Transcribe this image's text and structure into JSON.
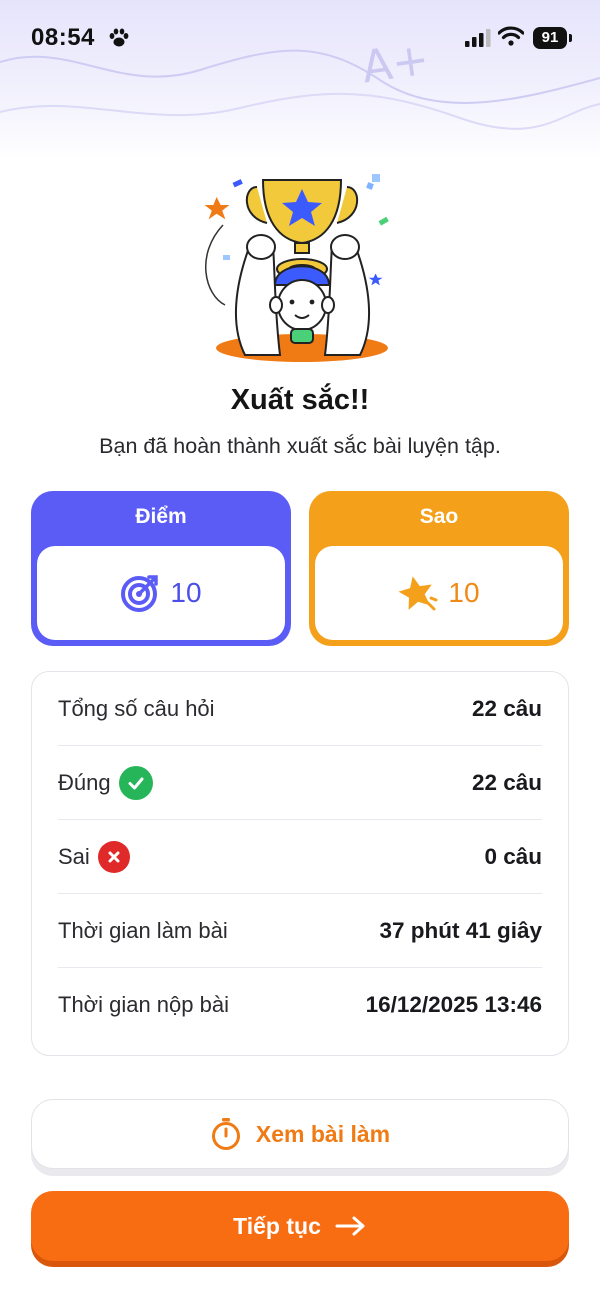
{
  "status_bar": {
    "time": "08:54",
    "battery": "91",
    "icons": [
      "paw-icon",
      "signal-icon",
      "wifi-icon",
      "battery-icon"
    ]
  },
  "header_decoration": {
    "doodle": "A+"
  },
  "result": {
    "title": "Xuất sắc!!",
    "subtitle": "Bạn đã hoàn thành xuất sắc bài luyện tập."
  },
  "score_cards": {
    "points": {
      "label": "Điểm",
      "value": "10",
      "icon": "target-icon",
      "color": "#5b5cf6"
    },
    "stars": {
      "label": "Sao",
      "value": "10",
      "icon": "star-icon",
      "color": "#f4a01a"
    }
  },
  "stats": [
    {
      "label": "Tổng số câu hỏi",
      "value": "22 câu"
    },
    {
      "label": "Đúng",
      "value": "22 câu",
      "icon": "check-circle-icon",
      "color": "#27b55a"
    },
    {
      "label": "Sai",
      "value": "0 câu",
      "icon": "x-circle-icon",
      "color": "#e02a2a"
    },
    {
      "label": "Thời gian làm bài",
      "value": "37 phút 41 giây"
    },
    {
      "label": "Thời gian nộp bài",
      "value": "16/12/2025 13:46"
    }
  ],
  "actions": {
    "review": {
      "label": "Xem bài làm",
      "icon": "stopwatch-icon",
      "color": "#f07a14"
    },
    "continue": {
      "label": "Tiếp tục",
      "icon": "arrow-right-icon",
      "color": "#f96d12"
    }
  }
}
